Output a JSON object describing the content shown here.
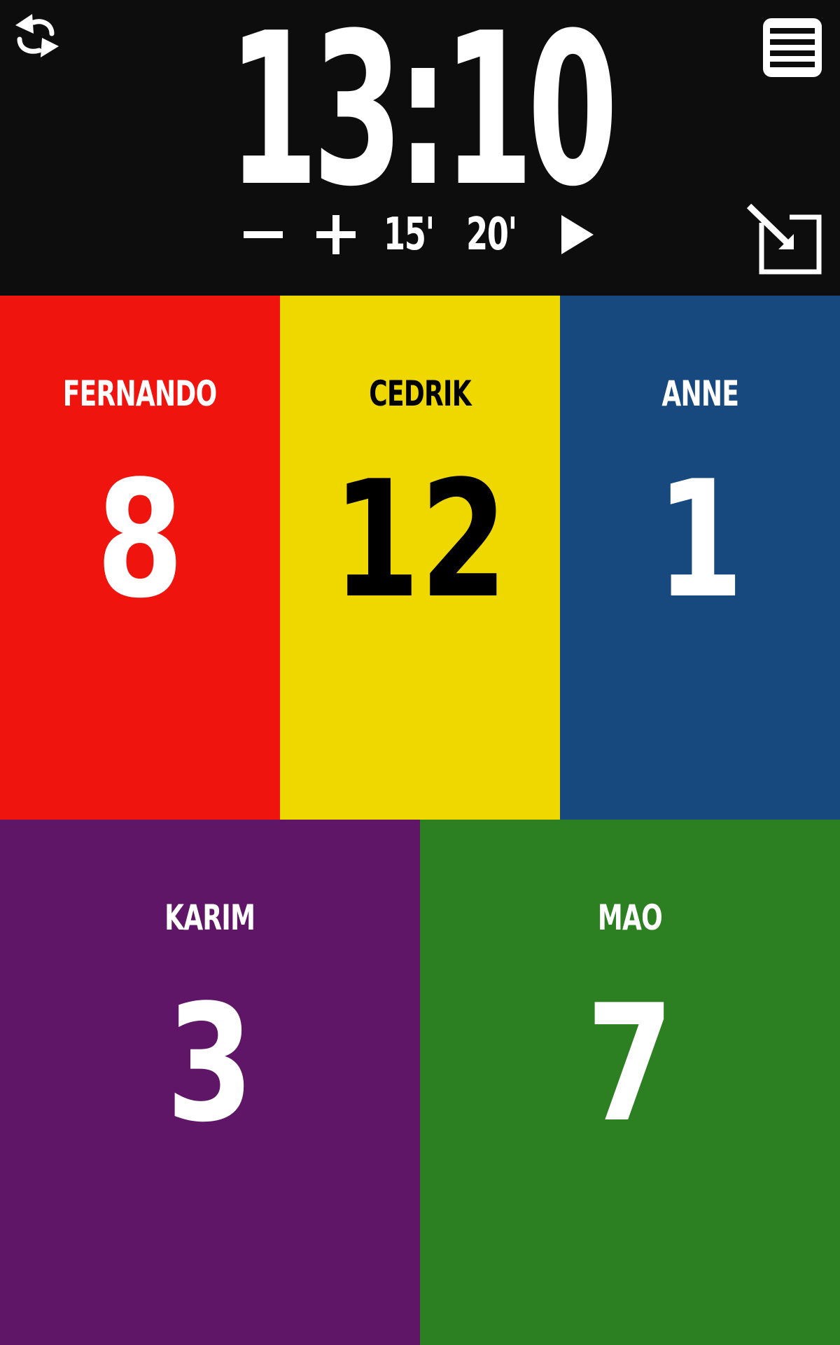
{
  "timer": {
    "display": "13:10",
    "minus_label": "minus",
    "plus_label": "plus",
    "preset_a": "15'",
    "preset_b": "20'"
  },
  "icons": {
    "sync": "sync-arrows-icon",
    "menu": "menu-icon",
    "expand": "expand-icon",
    "play": "play-icon",
    "minus": "minus-icon",
    "plus": "plus-icon"
  },
  "players": [
    {
      "name": "FERNANDO",
      "score": "8",
      "color": "#f0140f",
      "text_color": "#ffffff"
    },
    {
      "name": "CEDRIK",
      "score": "12",
      "color": "#efd800",
      "text_color": "#000000"
    },
    {
      "name": "ANNE",
      "score": "1",
      "color": "#17497f",
      "text_color": "#ffffff"
    },
    {
      "name": "KARIM",
      "score": "3",
      "color": "#5f1666",
      "text_color": "#ffffff"
    },
    {
      "name": "MAO",
      "score": "7",
      "color": "#2c8021",
      "text_color": "#ffffff"
    }
  ],
  "colors": {
    "background": "#0d0d0d",
    "foreground": "#ffffff"
  }
}
